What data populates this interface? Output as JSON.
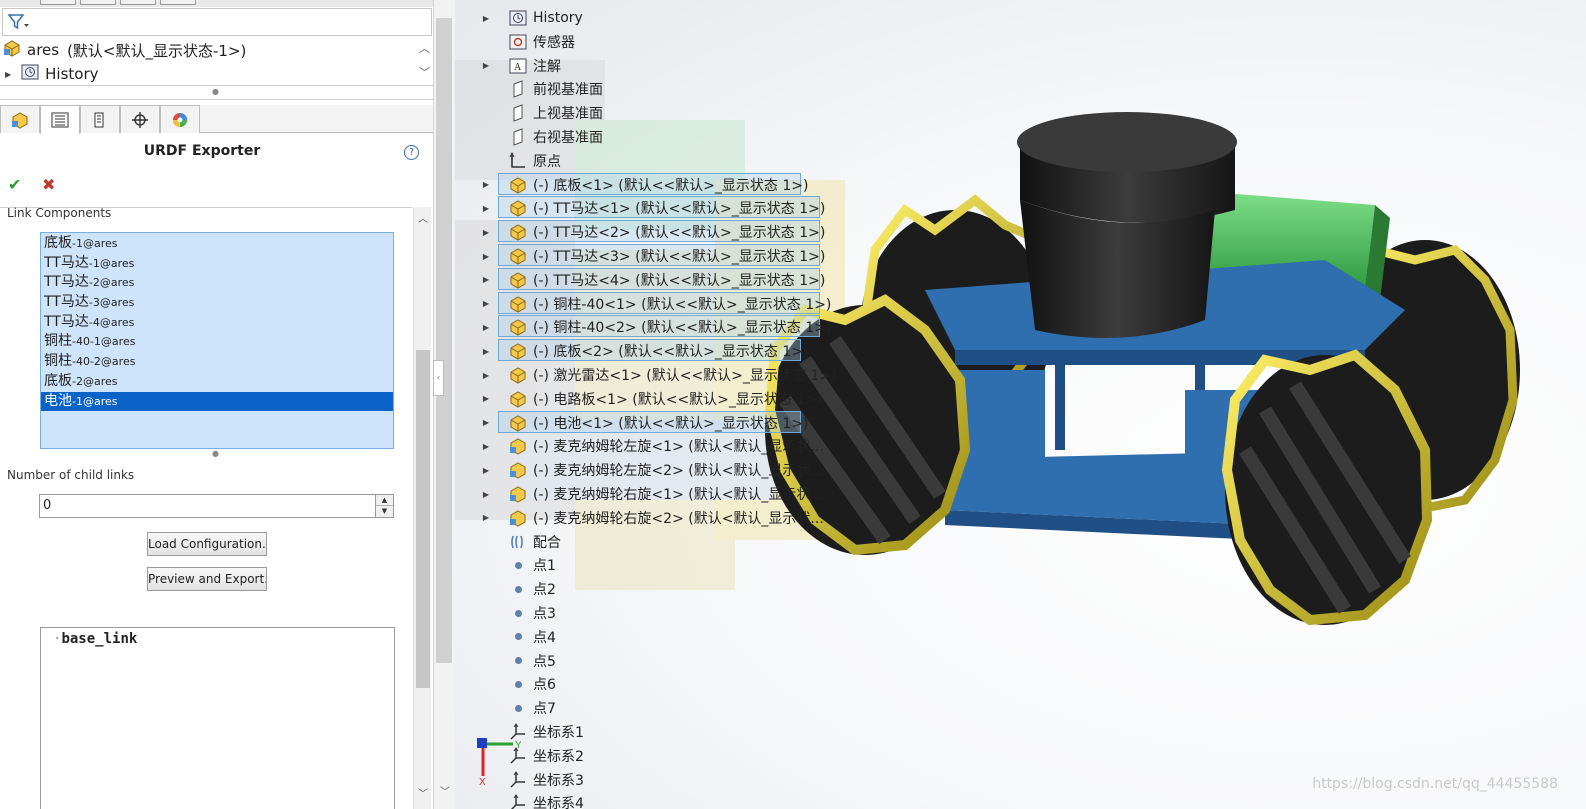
{
  "left_panel": {
    "tree": {
      "root_label": "ares",
      "root_suffix": "(默认<默认_显示状态-1>)",
      "history_label": "History"
    },
    "property_manager": {
      "title": "URDF Exporter",
      "help_glyph": "?",
      "ok_glyph": "✔",
      "cancel_glyph": "✖",
      "link_components_label": "Link Components",
      "link_components": [
        {
          "name": "底板",
          "suffix": "-1@ares"
        },
        {
          "name": "TT马达",
          "suffix": "-1@ares"
        },
        {
          "name": "TT马达",
          "suffix": "-2@ares"
        },
        {
          "name": "TT马达",
          "suffix": "-3@ares"
        },
        {
          "name": "TT马达",
          "suffix": "-4@ares"
        },
        {
          "name": "铜柱",
          "suffix": "-40-1@ares"
        },
        {
          "name": "铜柱",
          "suffix": "-40-2@ares"
        },
        {
          "name": "底板",
          "suffix": "-2@ares"
        },
        {
          "name": "电池",
          "suffix": "-1@ares"
        }
      ],
      "selected_index": 8,
      "child_links_label": "Number of child links",
      "child_links_value": "0",
      "load_button": "Load Configuration..",
      "preview_button": "Preview and Export..",
      "link_tree_root": "base_link"
    }
  },
  "viewport": {
    "feature_tree": [
      {
        "label": "History",
        "icon": "history-icon",
        "expandable": true
      },
      {
        "label": "传感器",
        "icon": "sensor-icon",
        "expandable": false
      },
      {
        "label": "注解",
        "icon": "annotation-icon",
        "expandable": true
      },
      {
        "label": "前视基准面",
        "icon": "plane-icon",
        "expandable": false
      },
      {
        "label": "上视基准面",
        "icon": "plane-icon",
        "expandable": false
      },
      {
        "label": "右视基准面",
        "icon": "plane-icon",
        "expandable": false
      },
      {
        "label": "原点",
        "icon": "origin-icon",
        "expandable": false
      },
      {
        "label": "(-) 底板<1> (默认<<默认>_显示状态 1>)",
        "icon": "part-icon",
        "expandable": true,
        "highlighted": true
      },
      {
        "label": "(-) TT马达<1> (默认<<默认>_显示状态 1>)",
        "icon": "part-icon",
        "expandable": true,
        "highlighted": true
      },
      {
        "label": "(-) TT马达<2> (默认<<默认>_显示状态 1>)",
        "icon": "part-icon",
        "expandable": true,
        "highlighted": true
      },
      {
        "label": "(-) TT马达<3> (默认<<默认>_显示状态 1>)",
        "icon": "part-icon",
        "expandable": true,
        "highlighted": true
      },
      {
        "label": "(-) TT马达<4> (默认<<默认>_显示状态 1>)",
        "icon": "part-icon",
        "expandable": true,
        "highlighted": true
      },
      {
        "label": "(-) 铜柱-40<1> (默认<<默认>_显示状态 1>)",
        "icon": "part-icon",
        "expandable": true,
        "highlighted": true
      },
      {
        "label": "(-) 铜柱-40<2> (默认<<默认>_显示状态 1>)",
        "icon": "part-icon",
        "expandable": true,
        "highlighted": true
      },
      {
        "label": "(-) 底板<2> (默认<<默认>_显示状态 1>)",
        "icon": "part-icon",
        "expandable": true,
        "highlighted": true
      },
      {
        "label": "(-) 激光雷达<1> (默认<<默认>_显示状态 1>)",
        "icon": "part-icon",
        "expandable": true,
        "highlighted": false
      },
      {
        "label": "(-) 电路板<1> (默认<<默认>_显示状态 1>)",
        "icon": "part-icon",
        "expandable": true,
        "highlighted": false
      },
      {
        "label": "(-) 电池<1> (默认<<默认>_显示状态 1>)",
        "icon": "part-icon",
        "expandable": true,
        "highlighted": true
      },
      {
        "label": "(-) 麦克纳姆轮左旋<1> (默认<默认_显示状...",
        "icon": "assembly-icon",
        "expandable": true,
        "highlighted": false
      },
      {
        "label": "(-) 麦克纳姆轮左旋<2> (默认<默认_显示状...",
        "icon": "assembly-icon",
        "expandable": true,
        "highlighted": false
      },
      {
        "label": "(-) 麦克纳姆轮右旋<1> (默认<默认_显示状...",
        "icon": "assembly-icon",
        "expandable": true,
        "highlighted": false
      },
      {
        "label": "(-) 麦克纳姆轮右旋<2> (默认<默认_显示状...",
        "icon": "assembly-icon",
        "expandable": true,
        "highlighted": false
      },
      {
        "label": "配合",
        "icon": "mate-icon",
        "expandable": false
      },
      {
        "label": "点1",
        "icon": "point-icon",
        "expandable": false
      },
      {
        "label": "点2",
        "icon": "point-icon",
        "expandable": false
      },
      {
        "label": "点3",
        "icon": "point-icon",
        "expandable": false
      },
      {
        "label": "点4",
        "icon": "point-icon",
        "expandable": false
      },
      {
        "label": "点5",
        "icon": "point-icon",
        "expandable": false
      },
      {
        "label": "点6",
        "icon": "point-icon",
        "expandable": false
      },
      {
        "label": "点7",
        "icon": "point-icon",
        "expandable": false
      },
      {
        "label": "坐标系1",
        "icon": "coordinate-system-icon",
        "expandable": false
      },
      {
        "label": "坐标系2",
        "icon": "coordinate-system-icon",
        "expandable": false
      },
      {
        "label": "坐标系3",
        "icon": "coordinate-system-icon",
        "expandable": false
      },
      {
        "label": "坐标系4",
        "icon": "coordinate-system-icon",
        "expandable": false
      }
    ],
    "triad_labels": {
      "x": "X",
      "y": "Y",
      "z": "Z"
    },
    "watermark": "https://blog.csdn.net/qq_44455588"
  },
  "colors": {
    "selection": "#0a63c9",
    "list_bg": "#cde4fb",
    "plate_blue": "#2f6fb0",
    "wheel_yellow": "#d9c52a",
    "battery_green": "#57c46a",
    "lidar_black": "#232323"
  }
}
